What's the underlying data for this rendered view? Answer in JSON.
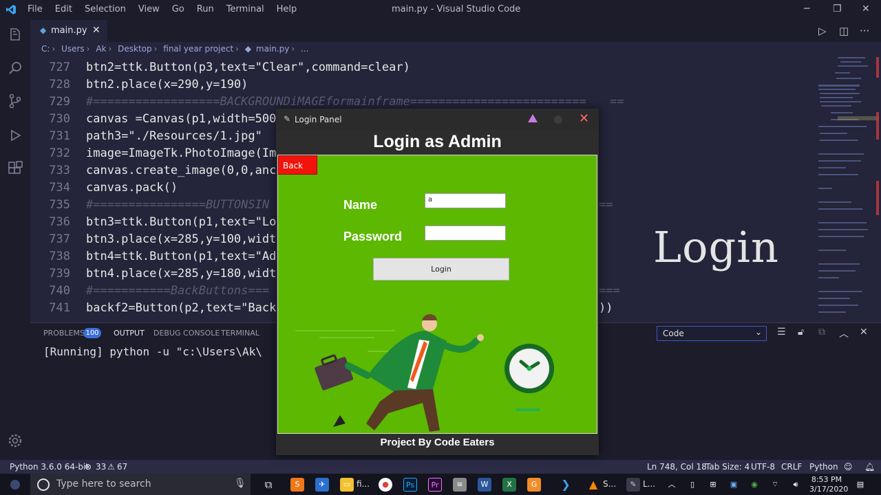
{
  "window": {
    "title": "main.py - Visual Studio Code",
    "menu": [
      "File",
      "Edit",
      "Selection",
      "View",
      "Go",
      "Run",
      "Terminal",
      "Help"
    ]
  },
  "tab": {
    "label": "main.py"
  },
  "breadcrumb": [
    "C:",
    "Users",
    "Ak",
    "Desktop",
    "final year project",
    "main.py",
    "..."
  ],
  "code": {
    "line_numbers": [
      "727",
      "728",
      "729",
      "730",
      "731",
      "732",
      "733",
      "734",
      "735",
      "736",
      "737",
      "738",
      "739",
      "740",
      "741"
    ],
    "lines": [
      "btn2=ttk.Button(p3,text=\"Clear\",command=clear)",
      "btn2.place(x=290,y=190)",
      "#==================BACKGROUNDiMAGEformainframe=========================",
      "canvas =Canvas(p1,width=500",
      "path3=\"./Resources/1.jpg\"",
      "image=ImageTk.PhotoImage(Im",
      "canvas.create_image(0,0,anc",
      "canvas.pack()",
      "#================BUTTONSIN",
      "btn3=ttk.Button(p1,text=\"Lo",
      "btn3.place(x=285,y=100,widt",
      "btn4=ttk.Button(p1,text=\"Ad",
      "btn4.place(x=285,y=180,widt",
      "#===========BackButtons===",
      "backf2=Button(p2,text=\"Back"
    ],
    "overflow_tail": "))",
    "background_text": "Login"
  },
  "panel": {
    "tabs": [
      "PROBLEMS",
      "OUTPUT",
      "DEBUG CONSOLE",
      "TERMINAL"
    ],
    "problems_count": "100",
    "active_tab": "OUTPUT",
    "output_line": "[Running] python -u \"c:\\Users\\Ak\\",
    "select_value": "Code"
  },
  "status": {
    "interpreter": "Python 3.6.0 64-bit",
    "errors": "33",
    "warnings": "67",
    "position": "Ln 748, Col 18",
    "tab_size": "Tab Size: 4",
    "encoding": "UTF-8",
    "eol": "CRLF",
    "language": "Python"
  },
  "taskbar": {
    "search_placeholder": "Type here to search",
    "time": "8:53 PM",
    "date": "3/17/2020",
    "item_labels": [
      "fi...",
      "S...",
      "L..."
    ]
  },
  "dialog": {
    "title": "Login Panel",
    "heading": "Login as Admin",
    "back_label": "Back",
    "name_label": "Name",
    "name_value": "a",
    "password_label": "Password",
    "password_value": "",
    "login_label": "Login",
    "footer": "Project By Code Eaters"
  },
  "colors": {
    "accent_green": "#5cb800",
    "back_red": "#f2140b",
    "problems_badge": "#3b6fd6"
  }
}
